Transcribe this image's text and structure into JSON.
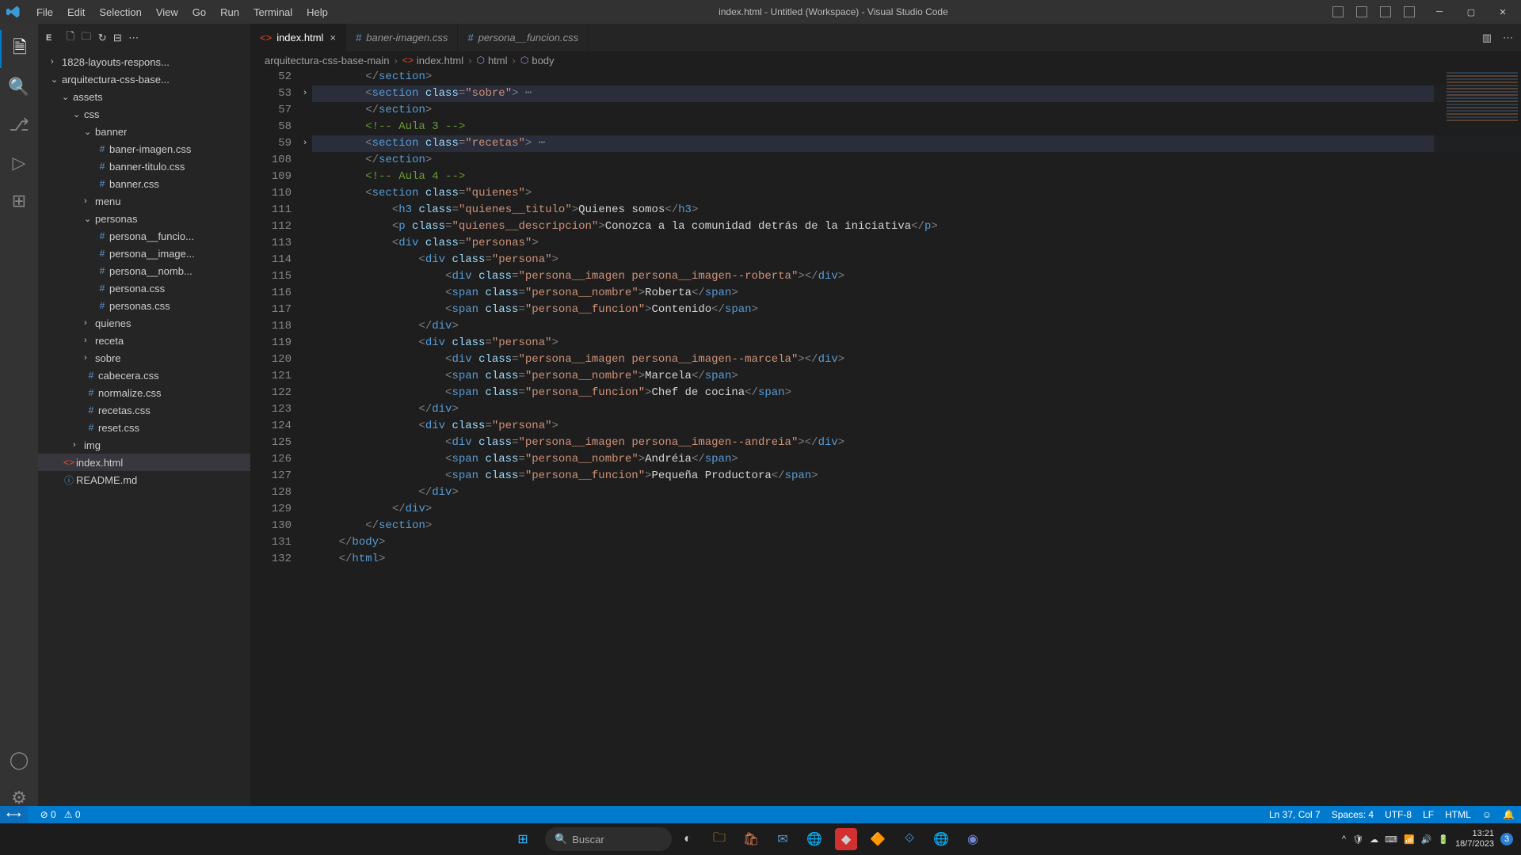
{
  "title": "index.html - Untitled (Workspace) - Visual Studio Code",
  "menu": [
    "File",
    "Edit",
    "Selection",
    "View",
    "Go",
    "Run",
    "Terminal",
    "Help"
  ],
  "sidebar_label": "E",
  "folders": {
    "f1": "1828-layouts-respons...",
    "f2": "arquitectura-css-base...",
    "assets": "assets",
    "css": "css",
    "banner": "banner",
    "menu": "menu",
    "personas": "personas",
    "quienes": "quienes",
    "receta": "receta",
    "sobre": "sobre",
    "img": "img"
  },
  "files": {
    "baner_imagen": "baner-imagen.css",
    "banner_titulo": "banner-titulo.css",
    "banner_css": "banner.css",
    "persona_funcio": "persona__funcio...",
    "persona_image": "persona__image...",
    "persona_nomb": "persona__nomb...",
    "persona_css": "persona.css",
    "personas_css": "personas.css",
    "cabecera": "cabecera.css",
    "normalize": "normalize.css",
    "recetas": "recetas.css",
    "reset": "reset.css",
    "index": "index.html",
    "readme": "README.md"
  },
  "tabs": {
    "t1": "index.html",
    "t2": "baner-imagen.css",
    "t3": "persona__funcion.css"
  },
  "breadcrumb": {
    "b1": "arquitectura-css-base-main",
    "b2": "index.html",
    "b3": "html",
    "b4": "body"
  },
  "lines": [
    "52",
    "53",
    "57",
    "58",
    "59",
    "108",
    "109",
    "110",
    "111",
    "112",
    "113",
    "114",
    "115",
    "116",
    "117",
    "118",
    "119",
    "120",
    "121",
    "122",
    "123",
    "124",
    "125",
    "126",
    "127",
    "128",
    "129",
    "130",
    "131",
    "132"
  ],
  "status": {
    "errors": "0",
    "warnings": "0",
    "pos": "Ln 37, Col 7",
    "spaces": "Spaces: 4",
    "enc": "UTF-8",
    "eol": "LF",
    "lang": "HTML"
  },
  "taskbar": {
    "search": "Buscar",
    "time": "13:21",
    "date": "18/7/2023"
  },
  "code": {
    "sobre": "sobre",
    "recetas": "recetas",
    "aula3": " Aula 3 ",
    "aula4": " Aula 4 ",
    "quienes": "quienes",
    "quienes_titulo_attr": "quienes__titulo",
    "quienes_somos": "Quienes somos",
    "quienes_desc_attr": "quienes__descripcion",
    "quienes_desc_text": "Conozca a la comunidad detrás de la iniciativa",
    "personas": "personas",
    "persona": "persona",
    "img_roberta": "persona__imagen persona__imagen--roberta",
    "img_marcela": "persona__imagen persona__imagen--marcela",
    "img_andreia": "persona__imagen persona__imagen--andreia",
    "nombre_attr": "persona__nombre",
    "funcion_attr": "persona__funcion",
    "roberta": "Roberta",
    "contenido": "Contenido",
    "marcela": "Marcela",
    "chef": "Chef de cocina",
    "andreia": "Andréia",
    "productora": "Pequeña Productora"
  }
}
